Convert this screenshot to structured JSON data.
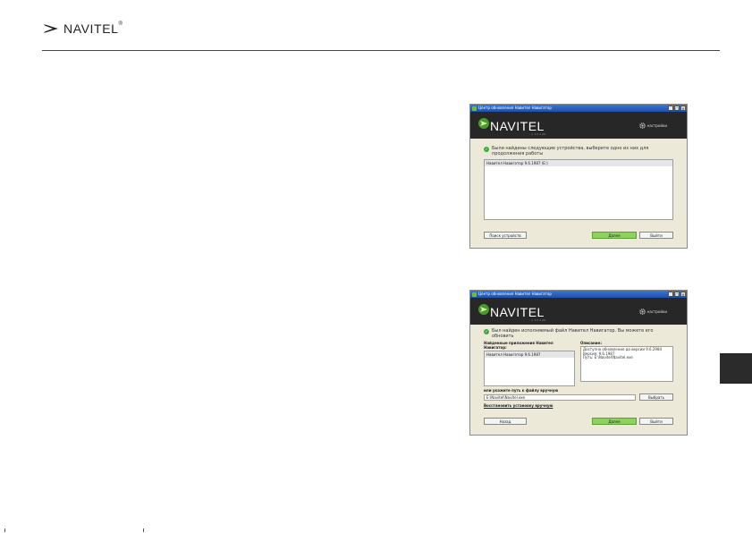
{
  "brand": {
    "name": "NAVITEL",
    "reg": "®"
  },
  "window1": {
    "title": "Центр обновления Навител Навигатор",
    "logo": "NAVITEL",
    "version": "v. 3.3.1.46",
    "settings": "настройки",
    "message": "Были найдены следующие устройства, выберите одно из них для продолжения работы",
    "device": "Навител Навигатор 9.6.1987 (E:)",
    "btn_search": "Поиск устройств",
    "btn_next": "Далее",
    "btn_exit": "Выйти"
  },
  "window2": {
    "title": "Центр обновления Навител Навигатор",
    "logo": "NAVITEL",
    "version": "v. 3.3.1.46",
    "settings": "настройки",
    "message": "Был найден исполняемый файл Навител Навигатор. Вы можете его обновить",
    "found_label": "Найденные приложения Навител Навигатор:",
    "found_item": "Навител Навигатор 9.6.1987",
    "desc_label": "Описание:",
    "desc_lines": [
      "Доступно обновление до версии 9.6.2984",
      "Версия: 9.6.1987",
      "Путь: E:\\Navitel\\Navitel.exe"
    ],
    "path_label": "или укажите путь к файлу вручную",
    "path_value": "E:\\Navitel\\Navitel.exe",
    "btn_choose": "Выбрать",
    "restore_link": "Восстановить установку вручную",
    "btn_back": "Назад",
    "btn_next": "Далее",
    "btn_exit": "Выйти"
  },
  "colors": {
    "accent_green": "#8bd35a",
    "header_dark": "#272727",
    "titlebar_blue": "#2a62c2"
  }
}
